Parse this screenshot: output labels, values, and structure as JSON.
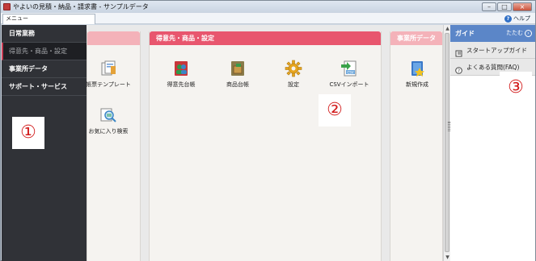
{
  "window": {
    "title": "やよいの見積・納品・請求書 - サンプルデータ",
    "controls": [
      "–",
      "□",
      "×"
    ]
  },
  "menubar": {
    "menu_label": "メニュー",
    "help_label": "ヘルプ",
    "help_icon": "help-circle-icon"
  },
  "sidebar": {
    "items": [
      {
        "label": "日常業務",
        "active": false
      },
      {
        "label": "得意先・商品・設定",
        "active": true
      },
      {
        "label": "事業所データ",
        "active": false
      },
      {
        "label": "サポート・サービス",
        "active": false
      }
    ],
    "active_accent": "#c83c52"
  },
  "main": {
    "panels": [
      {
        "title": "",
        "color": "#f4b2b9",
        "tiles": [
          {
            "label": "帳票テンプレート",
            "icon": "form-template-icon"
          },
          {
            "label": "お気に入り検索",
            "icon": "favorite-search-icon"
          }
        ]
      },
      {
        "title": "得意先・商品・設定",
        "color": "#e8566e",
        "tiles": [
          {
            "label": "得意先台帳",
            "icon": "customer-ledger-icon"
          },
          {
            "label": "商品台帳",
            "icon": "product-ledger-icon"
          },
          {
            "label": "設定",
            "icon": "gear-icon"
          },
          {
            "label": "CSVインポート",
            "icon": "csv-import-icon"
          }
        ]
      },
      {
        "title": "事業所データ",
        "color": "#f4b2b9",
        "tiles": [
          {
            "label": "新規作成",
            "icon": "new-data-icon"
          }
        ]
      }
    ]
  },
  "guide": {
    "title": "ガイド",
    "collapse_label": "たたむ",
    "items": [
      {
        "label": "スタートアップガイド",
        "icon": "book-icon"
      },
      {
        "label": "よくある質問(FAQ)",
        "icon": "question-icon"
      }
    ],
    "header_color": "#5b86c8"
  },
  "markers": [
    "①",
    "②",
    "③"
  ]
}
